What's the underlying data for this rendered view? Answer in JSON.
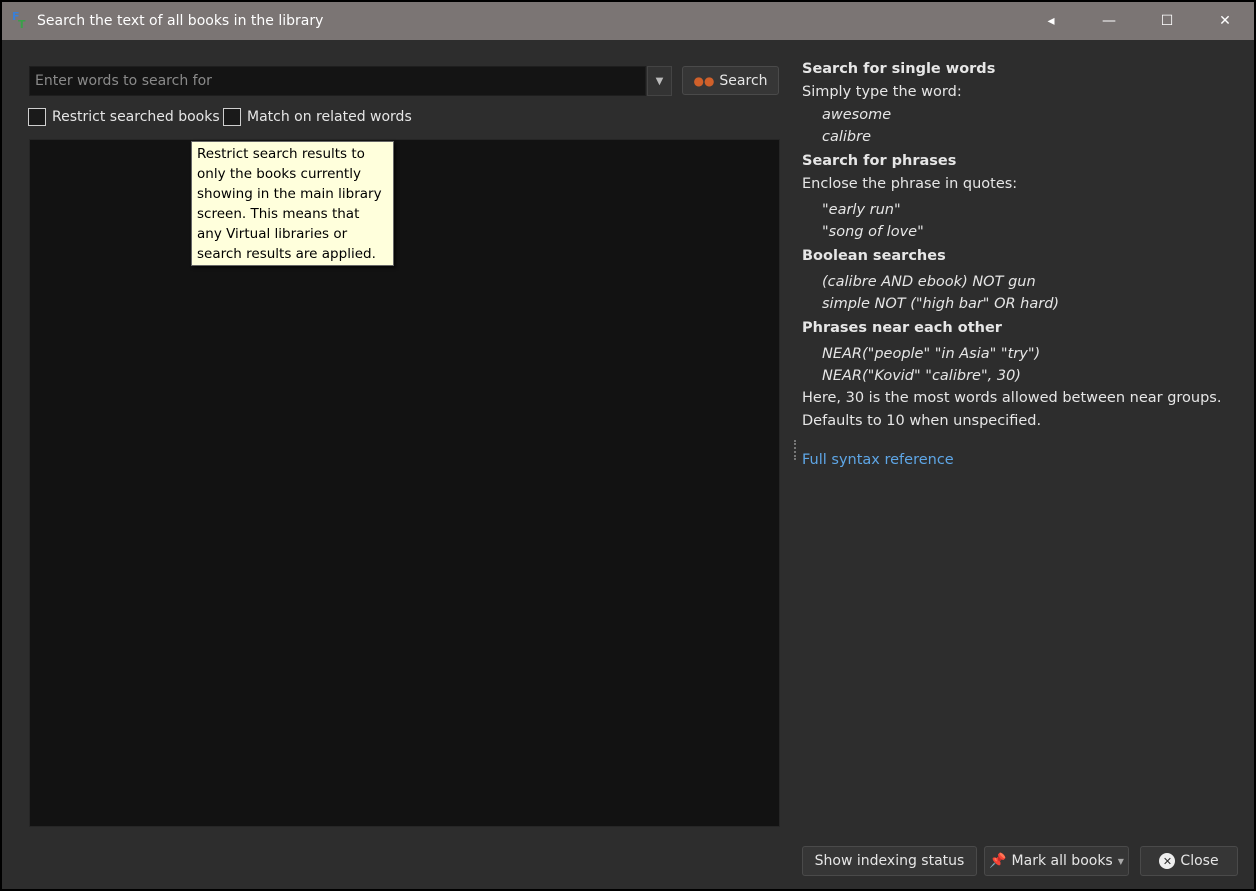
{
  "window": {
    "title": "Search the text of all books in the library",
    "controls": [
      "◂",
      "—",
      "☐",
      "✕"
    ]
  },
  "search": {
    "placeholder": "Enter words to search for",
    "button_label": "Search"
  },
  "options": {
    "restrict": "Restrict searched books",
    "related": "Match on related words"
  },
  "tooltip": "Restrict search results to only the books currently showing in the main library screen. This means that any Virtual libraries or search results are applied.",
  "help": {
    "h1": "Search for single words",
    "p1": "Simply type the word:",
    "e1": [
      "awesome",
      "calibre"
    ],
    "h2": "Search for phrases",
    "p2": "Enclose the phrase in quotes:",
    "e2": [
      "\"early run\"",
      "\"song of love\""
    ],
    "h3": "Boolean searches",
    "e3": [
      "(calibre AND ebook) NOT gun",
      "simple NOT (\"high bar\" OR hard)"
    ],
    "h4": "Phrases near each other",
    "e4": [
      "NEAR(\"people\" \"in Asia\" \"try\")",
      "NEAR(\"Kovid\" \"calibre\", 30)"
    ],
    "p4a": "Here, 30 is the most words allowed between near groups.",
    "p4b": "Defaults to 10 when unspecified.",
    "link": "Full syntax reference"
  },
  "footer": {
    "indexing": "Show indexing status",
    "mark": "Mark all books",
    "close": "Close"
  }
}
